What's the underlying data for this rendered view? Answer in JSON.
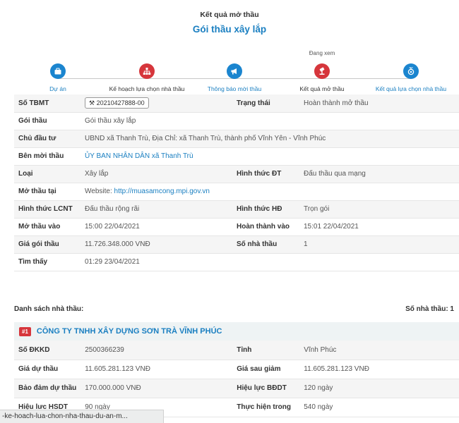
{
  "header": {
    "subtitle": "Kết quả mở thầu",
    "title": "Gói thầu xây lắp"
  },
  "steps": {
    "current_label": "Đang xem",
    "items": [
      {
        "label": "Dự án",
        "icon": "briefcase-icon",
        "color": "#1b85cf"
      },
      {
        "label": "Kế hoạch lựa chọn nhà thầu",
        "icon": "sitemap-icon",
        "color": "#d6363c"
      },
      {
        "label": "Thông báo mời thầu",
        "icon": "megaphone-icon",
        "color": "#1b85cf"
      },
      {
        "label": "Kết quả mở thầu",
        "icon": "gavel-icon",
        "color": "#d6363c"
      },
      {
        "label": "Kết quả lựa chọn nhà thầu",
        "icon": "medal-icon",
        "color": "#1b85cf"
      }
    ]
  },
  "info": {
    "so_tbmt_label": "Số TBMT",
    "so_tbmt_value": "20210427888-00",
    "trang_thai_label": "Trạng thái",
    "trang_thai_value": "Hoàn thành mở thầu",
    "goi_thau_label": "Gói thầu",
    "goi_thau_value": "Gói thầu xây lắp",
    "chu_dau_tu_label": "Chủ đầu tư",
    "chu_dau_tu_value": "UBND xã Thanh Trù, Địa Chỉ: xã Thanh Trù, thành phố Vĩnh Yên - Vĩnh Phúc",
    "ben_moi_thau_label": "Bên mời thầu",
    "ben_moi_thau_value": "ỦY BAN NHÂN DÂN xã Thanh Trù",
    "loai_label": "Loại",
    "loai_value": "Xây lắp",
    "hinh_thuc_dt_label": "Hình thức ĐT",
    "hinh_thuc_dt_value": "Đấu thầu qua mạng",
    "mo_thau_tai_label": "Mở thầu tại",
    "mo_thau_tai_prefix": "Website:",
    "mo_thau_tai_link": "http://muasamcong.mpi.gov.vn",
    "hinh_thuc_lcnt_label": "Hình thức LCNT",
    "hinh_thuc_lcnt_value": "Đấu thầu rộng rãi",
    "hinh_thuc_hd_label": "Hình thức HĐ",
    "hinh_thuc_hd_value": "Trọn gói",
    "mo_thau_vao_label": "Mở thầu vào",
    "mo_thau_vao_value": "15:00 22/04/2021",
    "hoan_thanh_vao_label": "Hoàn thành vào",
    "hoan_thanh_vao_value": "15:01 22/04/2021",
    "gia_goi_thau_label": "Giá gói thầu",
    "gia_goi_thau_value": "11.726.348.000 VNĐ",
    "so_nha_thau_label": "Số nhà thầu",
    "so_nha_thau_value": "1",
    "tim_thay_label": "Tìm thấy",
    "tim_thay_value": "01:29 23/04/2021"
  },
  "bidders": {
    "list_label": "Danh sách nhà thầu:",
    "count_label": "Số nhà thầu: 1",
    "first": {
      "rank": "#1",
      "name": "CÔNG TY TNHH XÂY DỰNG SƠN TRÀ VĨNH PHÚC",
      "so_dkkd_label": "Số ĐKKD",
      "so_dkkd_value": "2500366239",
      "tinh_label": "Tỉnh",
      "tinh_value": "Vĩnh Phúc",
      "gia_du_thau_label": "Giá dự thầu",
      "gia_du_thau_value": "11.605.281.123 VNĐ",
      "gia_sau_giam_label": "Giá sau giảm",
      "gia_sau_giam_value": "11.605.281.123 VNĐ",
      "bao_dam_label": "Bảo đảm dự thầu",
      "bao_dam_value": "170.000.000 VNĐ",
      "hieu_luc_bddt_label": "Hiệu lực BĐDT",
      "hieu_luc_bddt_value": "120 ngày",
      "hieu_luc_hsdt_label": "Hiệu lực HSDT",
      "hieu_luc_hsdt_value": "90 ngày",
      "thuc_hien_label": "Thực hiện trong",
      "thuc_hien_value": "540 ngày"
    }
  },
  "statusbar": {
    "url": "-ke-hoach-lua-chon-nha-thau-du-an-m..."
  },
  "colors": {
    "accent_blue": "#1a7fc1",
    "accent_red": "#d6363c"
  }
}
